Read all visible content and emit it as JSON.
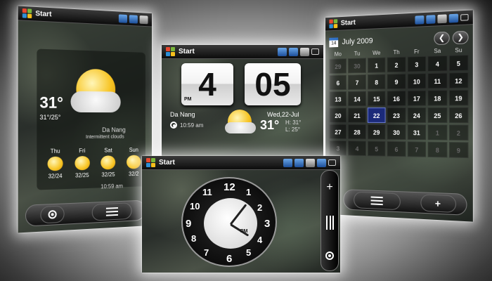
{
  "start_label": "Start",
  "weather": {
    "temp": "31°",
    "range": "31°/25°",
    "city": "Da Nang",
    "condition": "Intermittent clouds",
    "time": "10:59 am",
    "forecast": [
      {
        "day": "Thu",
        "temps": "32/24"
      },
      {
        "day": "Fri",
        "temps": "32/25"
      },
      {
        "day": "Sat",
        "temps": "32/25"
      },
      {
        "day": "Sun",
        "temps": "32/2"
      }
    ]
  },
  "flip_clock": {
    "hour": "4",
    "minute": "05",
    "ampm": "PM",
    "city": "Da Nang",
    "date": "Wed,22-Jul",
    "temp": "31°",
    "high": "H: 31°",
    "low": "L: 25°",
    "local_time": "10:59 am"
  },
  "calendar": {
    "icon_day": "14",
    "month": "July 2009",
    "prev_label": "❮",
    "next_label": "❯",
    "weekdays": [
      "Mo",
      "Tu",
      "We",
      "Th",
      "Fr",
      "Sa",
      "Su"
    ],
    "rows": [
      [
        "29",
        "30",
        "1",
        "2",
        "3",
        "4",
        "5"
      ],
      [
        "6",
        "7",
        "8",
        "9",
        "10",
        "11",
        "12"
      ],
      [
        "13",
        "14",
        "15",
        "16",
        "17",
        "18",
        "19"
      ],
      [
        "20",
        "21",
        "22",
        "23",
        "24",
        "25",
        "26"
      ],
      [
        "27",
        "28",
        "29",
        "30",
        "31",
        "1",
        "2"
      ],
      [
        "3",
        "4",
        "5",
        "6",
        "7",
        "8",
        "9"
      ]
    ]
  },
  "analog_clock": {
    "numbers": [
      "12",
      "1",
      "2",
      "3",
      "4",
      "5",
      "6",
      "7",
      "8",
      "9",
      "10",
      "11"
    ],
    "ampm": "PM"
  },
  "controls": {
    "plus": "+",
    "menu_label": "",
    "plus_right": "+"
  }
}
